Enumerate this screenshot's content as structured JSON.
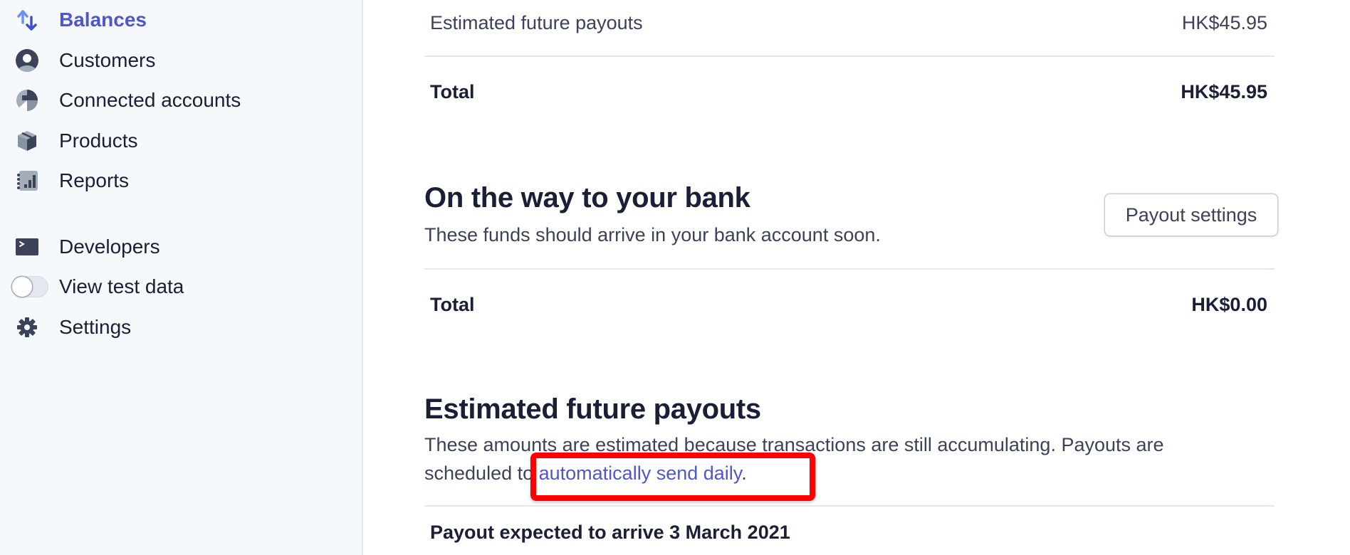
{
  "sidebar": {
    "items": [
      {
        "label": "Balances",
        "icon": "arrows-up-down-icon",
        "active": true
      },
      {
        "label": "Customers",
        "icon": "customer-icon"
      },
      {
        "label": "Connected accounts",
        "icon": "connected-accounts-icon"
      },
      {
        "label": "Products",
        "icon": "product-box-icon"
      },
      {
        "label": "Reports",
        "icon": "reports-icon"
      },
      {
        "label": "Developers",
        "icon": "terminal-icon"
      },
      {
        "label": "View test data",
        "icon": "toggle-switch",
        "toggle_on": false
      },
      {
        "label": "Settings",
        "icon": "gear-icon"
      }
    ]
  },
  "main": {
    "summary": {
      "rows": [
        {
          "label": "Estimated future payouts",
          "value": "HK$45.95"
        }
      ],
      "total": {
        "label": "Total",
        "value": "HK$45.95"
      }
    },
    "on_the_way": {
      "title": "On the way to your bank",
      "description": "These funds should arrive in your bank account soon.",
      "button_label": "Payout settings",
      "total": {
        "label": "Total",
        "value": "HK$0.00"
      }
    },
    "future_payouts": {
      "title": "Estimated future payouts",
      "description_prefix": "These amounts are estimated because transactions are still accumulating. Payouts are scheduled to ",
      "link_text": "automatically send daily",
      "description_suffix": ".",
      "payout_row": "Payout expected to arrive 3 March 2021"
    }
  },
  "colors": {
    "accent": "#4f56c9",
    "highlight": "#ff0000",
    "sidebar_bg": "#f6f9fc",
    "divider": "#e3e8ee"
  }
}
